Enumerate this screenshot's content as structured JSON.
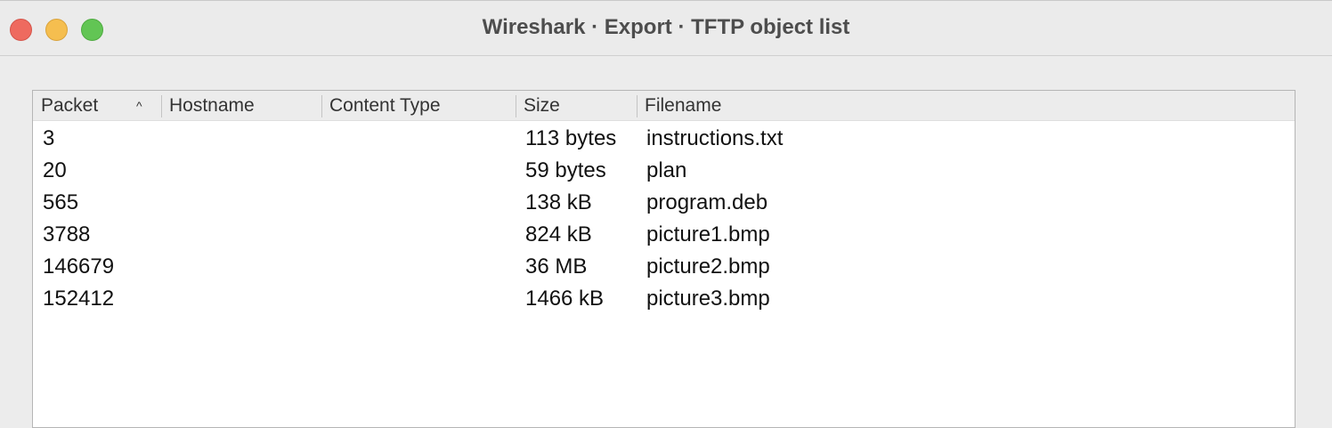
{
  "window": {
    "title": "Wireshark · Export · TFTP object list"
  },
  "table": {
    "columns": [
      "Packet",
      "Hostname",
      "Content Type",
      "Size",
      "Filename"
    ],
    "sort_column": "Packet",
    "sort_indicator": "^",
    "rows": [
      {
        "packet": "3",
        "hostname": "",
        "content_type": "",
        "size": "113 bytes",
        "filename": "instructions.txt"
      },
      {
        "packet": "20",
        "hostname": "",
        "content_type": "",
        "size": "59 bytes",
        "filename": "plan"
      },
      {
        "packet": "565",
        "hostname": "",
        "content_type": "",
        "size": "138 kB",
        "filename": "program.deb"
      },
      {
        "packet": "3788",
        "hostname": "",
        "content_type": "",
        "size": "824 kB",
        "filename": "picture1.bmp"
      },
      {
        "packet": "146679",
        "hostname": "",
        "content_type": "",
        "size": "36 MB",
        "filename": "picture2.bmp"
      },
      {
        "packet": "152412",
        "hostname": "",
        "content_type": "",
        "size": "1466 kB",
        "filename": "picture3.bmp"
      }
    ]
  }
}
